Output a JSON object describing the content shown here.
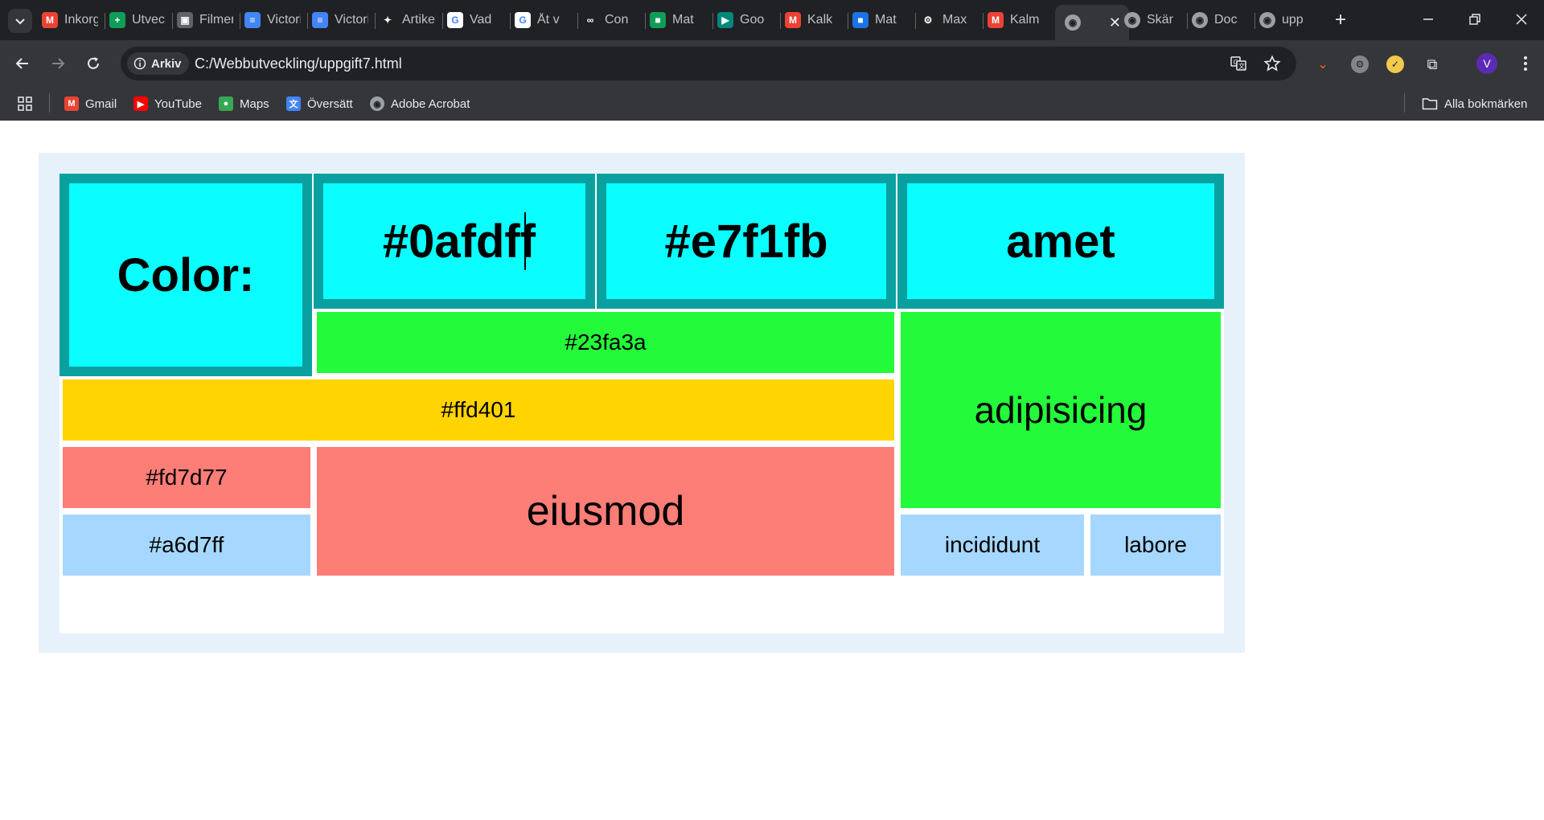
{
  "browser": {
    "tabs": [
      {
        "title": "Inkorg",
        "icon": "gmail-icon",
        "color": "#ea4335",
        "glyph": "M"
      },
      {
        "title": "Utveckling",
        "icon": "sheets-icon",
        "color": "#0f9d58",
        "glyph": "+"
      },
      {
        "title": "Filmer",
        "icon": "photo-icon",
        "color": "#5f6368",
        "glyph": "▣"
      },
      {
        "title": "Victoria",
        "icon": "docs-icon",
        "color": "#4285f4",
        "glyph": "≡"
      },
      {
        "title": "Victoria",
        "icon": "docs-icon",
        "color": "#4285f4",
        "glyph": "≡"
      },
      {
        "title": "Artikel",
        "icon": "ai-icon",
        "color": "#202124",
        "glyph": "✦"
      },
      {
        "title": "Vad",
        "icon": "google-icon",
        "color": "#ffffff",
        "glyph": "G"
      },
      {
        "title": "Åt v",
        "icon": "google-icon",
        "color": "#ffffff",
        "glyph": "G"
      },
      {
        "title": "Con",
        "icon": "loop-icon",
        "color": "#202124",
        "glyph": "∞"
      },
      {
        "title": "Mat",
        "icon": "classroom-icon",
        "color": "#0f9d58",
        "glyph": "■"
      },
      {
        "title": "Goo",
        "icon": "meet-icon",
        "color": "#00897b",
        "glyph": "▶"
      },
      {
        "title": "Kalk",
        "icon": "gmail-icon",
        "color": "#ea4335",
        "glyph": "M"
      },
      {
        "title": "Mat",
        "icon": "contacts-icon",
        "color": "#1a73e8",
        "glyph": "■"
      },
      {
        "title": "Max",
        "icon": "openai-icon",
        "color": "#202124",
        "glyph": "⚙"
      },
      {
        "title": "Kalm",
        "icon": "gmail-icon",
        "color": "#ea4335",
        "glyph": "M"
      },
      {
        "title": "",
        "icon": "globe-icon",
        "color": "#5f6368",
        "glyph": "◉",
        "active": true
      },
      {
        "title": "Skär",
        "icon": "globe-icon",
        "color": "#5f6368",
        "glyph": "◉"
      },
      {
        "title": "Doc",
        "icon": "globe-icon",
        "color": "#5f6368",
        "glyph": "◉"
      },
      {
        "title": "upp",
        "icon": "globe-icon",
        "color": "#5f6368",
        "glyph": "◉"
      }
    ],
    "omnibox": {
      "chip_label": "Arkiv",
      "url": "C:/Webbutveckling/uppgift7.html"
    },
    "avatar_letter": "V",
    "bookmarks": [
      {
        "label": "Gmail",
        "icon": "gmail-icon",
        "color": "#ea4335",
        "glyph": "M"
      },
      {
        "label": "YouTube",
        "icon": "youtube-icon",
        "color": "#ff0000",
        "glyph": "▶"
      },
      {
        "label": "Maps",
        "icon": "maps-icon",
        "color": "#34a853",
        "glyph": "●"
      },
      {
        "label": "Översätt",
        "icon": "translate-icon",
        "color": "#4285f4",
        "glyph": "文"
      },
      {
        "label": "Adobe Acrobat",
        "icon": "globe-icon",
        "color": "#5f6368",
        "glyph": "◉"
      }
    ],
    "all_bookmarks_label": "Alla bokmärken"
  },
  "page": {
    "color_label": "Color:",
    "hex1": "#0afdff",
    "hex2": "#e7f1fb",
    "amet": "amet",
    "green_hex": "#23fa3a",
    "adipisicing": "adipisicing",
    "yellow_hex": "#ffd401",
    "pink_hex": "#fd7d77",
    "eiusmod": "eiusmod",
    "blue_hex": "#a6d7ff",
    "incididunt": "incididunt",
    "labore": "labore"
  },
  "colors": {
    "cyan": "#0afdff",
    "teal_border": "#0aa0a0",
    "green": "#23fa3a",
    "yellow": "#ffd401",
    "pink": "#fd7d77",
    "blue": "#a6d7ff",
    "wrapper": "#e7f1fb"
  }
}
